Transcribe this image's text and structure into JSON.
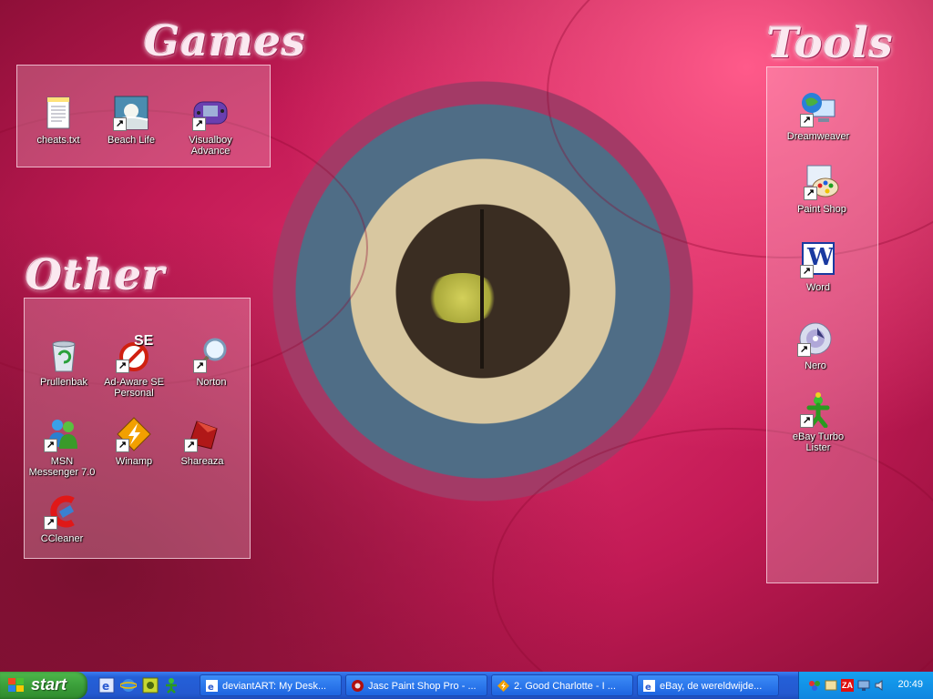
{
  "groups": {
    "games": {
      "title": "Games",
      "icons": [
        {
          "label": "cheats.txt",
          "icon": "text-file-icon"
        },
        {
          "label": "Beach Life",
          "icon": "beach-life-icon"
        },
        {
          "label": "Visualboy Advance",
          "icon": "gameboy-icon"
        }
      ]
    },
    "other": {
      "title": "Other",
      "icons": [
        {
          "label": "Prullenbak",
          "icon": "recycle-bin-icon"
        },
        {
          "label": "Ad-Aware SE Personal",
          "icon": "ad-aware-icon",
          "badge": "SE"
        },
        {
          "label": "Norton",
          "icon": "magnifier-icon"
        },
        {
          "label": "MSN Messenger 7.0",
          "icon": "msn-messenger-icon"
        },
        {
          "label": "Winamp",
          "icon": "winamp-icon"
        },
        {
          "label": "Shareaza",
          "icon": "shareaza-icon"
        },
        {
          "label": "CCleaner",
          "icon": "ccleaner-icon"
        }
      ]
    },
    "tools": {
      "title": "Tools",
      "icons": [
        {
          "label": "Dreamweaver",
          "icon": "dreamweaver-icon"
        },
        {
          "label": "Paint Shop",
          "icon": "paint-palette-icon"
        },
        {
          "label": "Word",
          "icon": "word-icon",
          "badge": "W"
        },
        {
          "label": "Nero",
          "icon": "nero-disc-icon"
        },
        {
          "label": "eBay Turbo Lister",
          "icon": "ebay-lister-icon"
        }
      ]
    }
  },
  "taskbar": {
    "start_label": "start",
    "quick_launch": [
      "internet-explorer-icon",
      "ie-icon",
      "media-icon",
      "green-man-icon"
    ],
    "tasks": [
      {
        "label": "deviantART: My Desk...",
        "icon": "ie-page-icon"
      },
      {
        "label": "Jasc Paint Shop Pro - ...",
        "icon": "jasc-icon"
      },
      {
        "label": "2. Good Charlotte - I ...",
        "icon": "winamp-task-icon"
      },
      {
        "label": "eBay, de wereldwijde...",
        "icon": "ie-page-icon"
      }
    ],
    "tray_icons": [
      "network-icon",
      "messenger-tray-icon",
      "zonealarm-icon",
      "monitor-icon",
      "speaker-icon"
    ],
    "tray_badge": "ZA",
    "clock": "20:49"
  },
  "colors": {
    "taskbar": "#2459d0",
    "start": "#3b9f3a",
    "tray": "#0f86e0",
    "flower": "#e4326f"
  }
}
